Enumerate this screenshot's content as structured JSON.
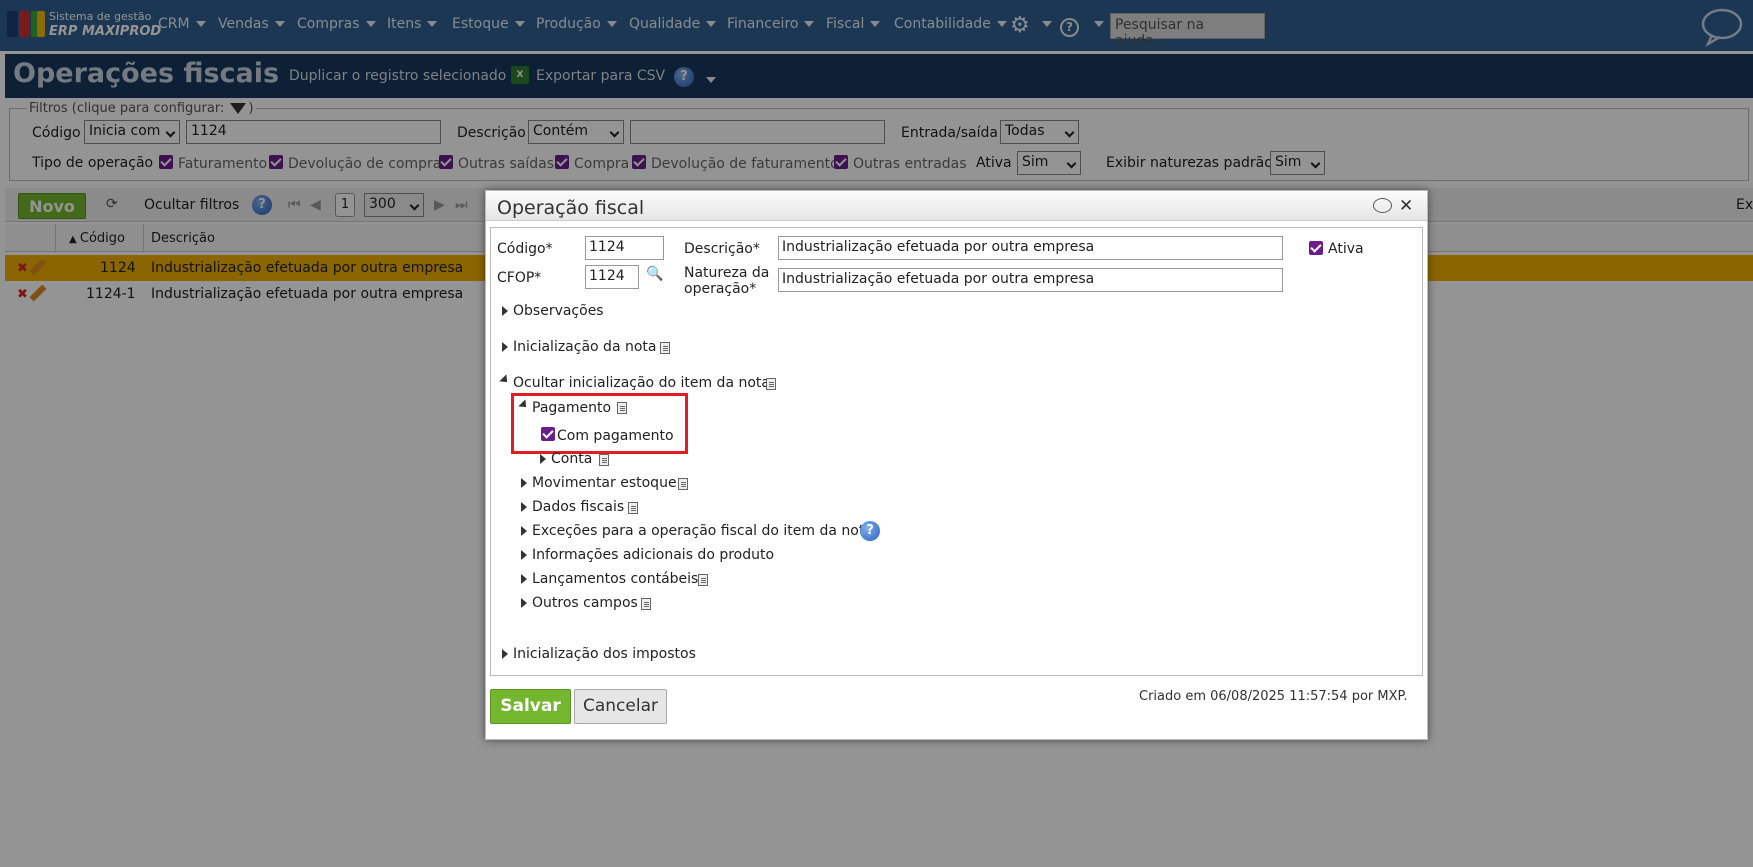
{
  "app": {
    "logo_line1": "Sistema de gestão",
    "logo_line2": "ERP MAXIPROD",
    "menu": [
      "CRM",
      "Vendas",
      "Compras",
      "Itens",
      "Estoque",
      "Produção",
      "Qualidade",
      "Financeiro",
      "Fiscal",
      "Contabilidade"
    ],
    "help_icon_label": "?",
    "search_placeholder": "Pesquisar na ajuda..."
  },
  "page": {
    "title": "Operações fiscais",
    "duplicate_label": "Duplicar o registro selecionado",
    "export_label": "Exportar para CSV",
    "help_label": "?"
  },
  "filters": {
    "legend": "Filtros (clique para configurar:",
    "legend_end": ")",
    "codigo_label": "Código",
    "codigo_op": "Inicia com",
    "codigo_value": "1124",
    "descricao_label": "Descrição",
    "descricao_op": "Contém",
    "descricao_value": "",
    "entrada_saida_label": "Entrada/saída",
    "entrada_saida_value": "Todas",
    "tipo_label": "Tipo de operação",
    "tipos": [
      "Faturamento",
      "Devolução de compra",
      "Outras saídas",
      "Compra",
      "Devolução de faturamento",
      "Outras entradas"
    ],
    "ativa_label": "Ativa",
    "ativa_value": "Sim",
    "naturezas_label": "Exibir naturezas padrão",
    "naturezas_value": "Sim"
  },
  "grid": {
    "novo_label": "Novo",
    "hide_filters_label": "Ocultar filtros",
    "page_number": "1",
    "page_size": "300",
    "right_label": "Ex",
    "columns": [
      "Código",
      "Descrição"
    ],
    "rows": [
      {
        "codigo": "1124",
        "descricao": "Industrialização efetuada por outra empresa"
      },
      {
        "codigo": "1124-1",
        "descricao": "Industrialização efetuada por outra empresa"
      }
    ]
  },
  "modal": {
    "title": "Operação fiscal",
    "codigo_label": "Código*",
    "codigo_value": "1124",
    "descricao_label": "Descrição*",
    "descricao_value": "Industrialização efetuada por outra empresa",
    "ativa_label": "Ativa",
    "cfop_label": "CFOP*",
    "cfop_value": "1124",
    "natureza_label_1": "Natureza da",
    "natureza_label_2": "operação*",
    "natureza_value": "Industrialização efetuada por outra empresa",
    "sections": {
      "observacoes": "Observações",
      "inicializacao_nota": "Inicialização da nota",
      "ocultar_item": "Ocultar inicialização do item da nota",
      "pagamento": "Pagamento",
      "com_pagamento": "Com pagamento",
      "conta": "Conta",
      "movimentar_estoque": "Movimentar estoque",
      "dados_fiscais": "Dados fiscais",
      "excecoes": "Exceções para a operação fiscal do item da nota",
      "info_adicionais": "Informações adicionais do produto",
      "lancamentos": "Lançamentos contábeis",
      "outros_campos": "Outros campos",
      "inicializacao_impostos": "Inicialização dos impostos"
    },
    "save_label": "Salvar",
    "cancel_label": "Cancelar",
    "created_text": "Criado em 06/08/2025 11:57:54 por MXP."
  },
  "colors": {
    "nav_bg": "#2f5f8f",
    "title_bg": "#17385c",
    "accent_green": "#74b72e",
    "selected_row": "#f0b000",
    "checkbox": "#6b1e8b",
    "highlight": "#e31b23"
  }
}
